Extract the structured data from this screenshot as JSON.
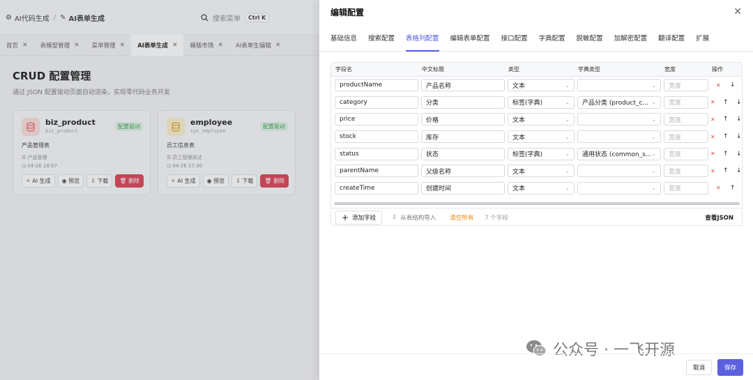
{
  "bg": {
    "breadcrumb": [
      "AI代码生成",
      "AI表单生成"
    ],
    "search_placeholder": "搜索菜单",
    "search_shortcut": "Ctrl K",
    "tabs": [
      {
        "label": "首页",
        "active": false
      },
      {
        "label": "表模型管理",
        "active": false
      },
      {
        "label": "菜单管理",
        "active": false
      },
      {
        "label": "AI表单生成",
        "active": true
      },
      {
        "label": "模版市场",
        "active": false
      },
      {
        "label": "AI表单生编辑",
        "active": false
      }
    ],
    "title": "CRUD 配置管理",
    "subtitle": "通过 JSON 配置驱动页面自动渲染，实现零代码业务开发",
    "cards": [
      {
        "name": "biz_product",
        "table": "biz_product",
        "badge": "配置驱动",
        "desc": "产品管理表",
        "menu": "产品管理",
        "time": "04-26 18:07",
        "icon_color": "red"
      },
      {
        "name": "employee",
        "table": "sys_employee",
        "badge": "配置驱动",
        "desc": "员工信息表",
        "menu": "员工管理测试",
        "time": "04-26 17:30",
        "icon_color": "yellow"
      }
    ],
    "card_actions": {
      "ai": "AI 生成",
      "preview": "预览",
      "download": "下载",
      "delete": "删除"
    }
  },
  "drawer": {
    "title": "编辑配置",
    "tabs": [
      "基础信息",
      "搜索配置",
      "表格列配置",
      "编辑表单配置",
      "接口配置",
      "字典配置",
      "脱敏配置",
      "加解密配置",
      "翻译配置",
      "扩展"
    ],
    "active_tab": "表格列配置",
    "columns": {
      "field": "字段名",
      "label": "中文标题",
      "type": "类型",
      "dict": "字典类型",
      "width": "宽度",
      "ops": "操作"
    },
    "width_placeholder": "宽度",
    "rows": [
      {
        "field": "productName",
        "label": "产品名称",
        "type": "文本",
        "dict": "",
        "up": false,
        "down": true
      },
      {
        "field": "category",
        "label": "分类",
        "type": "标签(字典)",
        "dict": "产品分类 (product_c...",
        "up": true,
        "down": true
      },
      {
        "field": "price",
        "label": "价格",
        "type": "文本",
        "dict": "",
        "up": true,
        "down": true
      },
      {
        "field": "stock",
        "label": "库存",
        "type": "文本",
        "dict": "",
        "up": true,
        "down": true
      },
      {
        "field": "status",
        "label": "状态",
        "type": "标签(字典)",
        "dict": "通用状态 (common_s...",
        "up": true,
        "down": true
      },
      {
        "field": "parentName",
        "label": "父级名称",
        "type": "文本",
        "dict": "",
        "up": true,
        "down": true
      },
      {
        "field": "createTime",
        "label": "创建时间",
        "type": "文本",
        "dict": "",
        "up": true,
        "down": false
      }
    ],
    "footer": {
      "add": "添加字段",
      "import": "从表结构导入",
      "clear": "清空所有",
      "count": "7 个字段",
      "view_json": "查看JSON"
    },
    "cancel": "取消",
    "save": "保存",
    "watermark": "公众号 · 一飞开源"
  }
}
